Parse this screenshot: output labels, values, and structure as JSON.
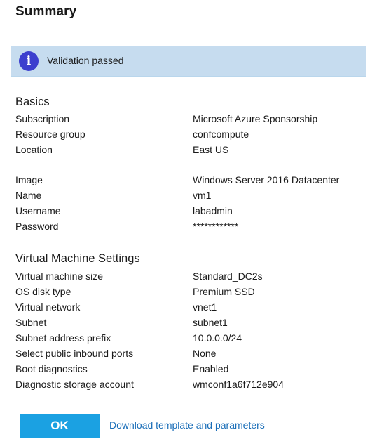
{
  "title": "Summary",
  "colors": {
    "banner_bg": "#c6dcef",
    "info_icon_bg": "#3c3fce",
    "ok_button_bg": "#1ba1e2",
    "link": "#1a6eb8"
  },
  "validation": {
    "icon": "info-icon",
    "icon_glyph": "i",
    "message": "Validation passed"
  },
  "basics": {
    "title": "Basics",
    "rows": [
      {
        "label": "Subscription",
        "value": "Microsoft Azure Sponsorship"
      },
      {
        "label": "Resource group",
        "value": "confcompute"
      },
      {
        "label": "Location",
        "value": "East US"
      },
      {
        "label": "Image",
        "value": "Windows Server 2016 Datacenter"
      },
      {
        "label": "Name",
        "value": "vm1"
      },
      {
        "label": "Username",
        "value": "labadmin"
      },
      {
        "label": "Password",
        "value": "************"
      }
    ]
  },
  "vm_settings": {
    "title": "Virtual Machine Settings",
    "rows": [
      {
        "label": "Virtual machine size",
        "value": "Standard_DC2s"
      },
      {
        "label": "OS disk type",
        "value": "Premium SSD"
      },
      {
        "label": "Virtual network",
        "value": "vnet1"
      },
      {
        "label": "Subnet",
        "value": "subnet1"
      },
      {
        "label": "Subnet address prefix",
        "value": "10.0.0.0/24"
      },
      {
        "label": "Select public inbound ports",
        "value": "None"
      },
      {
        "label": "Boot diagnostics",
        "value": "Enabled"
      },
      {
        "label": "Diagnostic storage account",
        "value": "wmconf1a6f712e904"
      }
    ]
  },
  "footer": {
    "ok_label": "OK",
    "download_label": "Download template and parameters"
  }
}
